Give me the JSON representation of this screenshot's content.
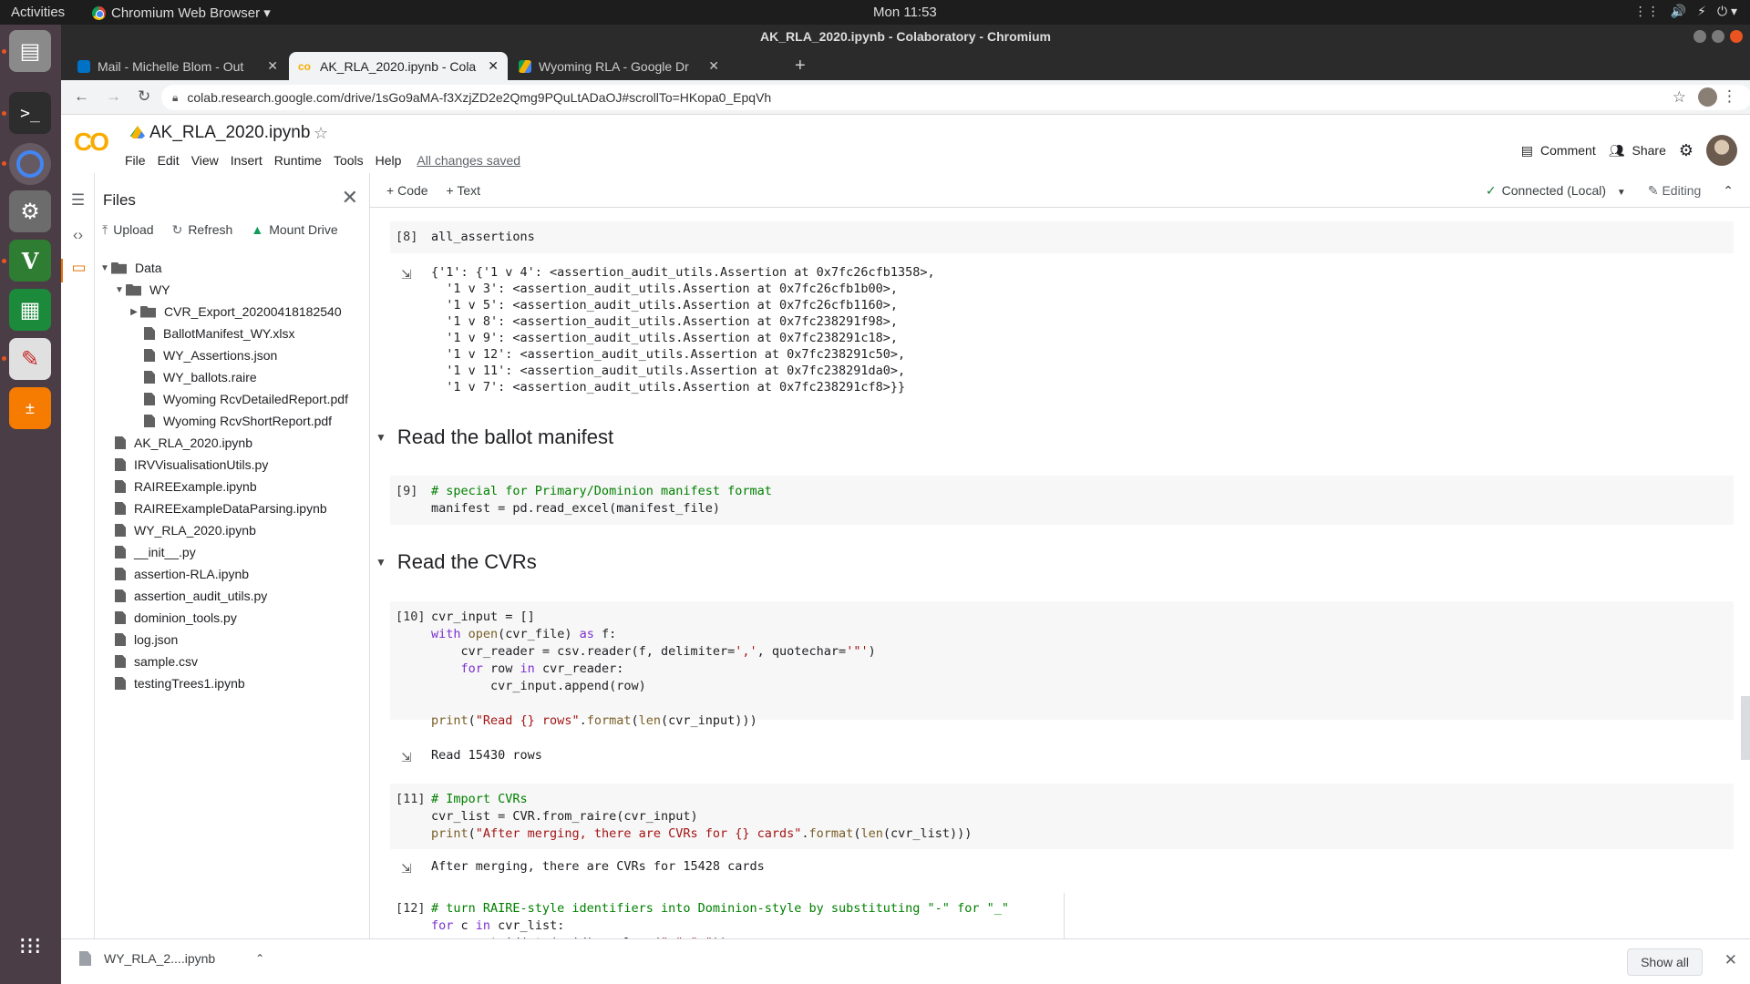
{
  "topbar": {
    "activities": "Activities",
    "app_name": "Chromium Web Browser ▾",
    "clock": "Mon 11:53",
    "tray": [
      "⋮⋮",
      "🔊",
      "⚡",
      "⏻ ▾"
    ]
  },
  "window": {
    "title": "AK_RLA_2020.ipynb - Colaboratory - Chromium"
  },
  "tabs": [
    {
      "label": "Mail - Michelle Blom - Out",
      "color": "#0072c6"
    },
    {
      "label": "AK_RLA_2020.ipynb - Cola",
      "color": "#f9ab00"
    },
    {
      "label": "Wyoming RLA - Google Dr",
      "color": "#0f9d58"
    }
  ],
  "url": "colab.research.google.com/drive/1sGo9aMA-f3XzjZD2e2Qmg9PQuLtADaOJ#scrollTo=HKopa0_EpqVh",
  "colab": {
    "logo": "CO",
    "notebook_name": "AK_RLA_2020.ipynb",
    "menus": [
      "File",
      "Edit",
      "View",
      "Insert",
      "Runtime",
      "Tools",
      "Help"
    ],
    "saved": "All changes saved",
    "comment": "Comment",
    "share": "Share"
  },
  "files": {
    "title": "Files",
    "upload": "Upload",
    "refresh": "Refresh",
    "mount": "Mount Drive",
    "tree": [
      {
        "name": "Data",
        "kind": "folder",
        "depth": 0,
        "caret": "▼"
      },
      {
        "name": "WY",
        "kind": "folder",
        "depth": 1,
        "caret": "▼"
      },
      {
        "name": "CVR_Export_20200418182540",
        "kind": "folder",
        "depth": 2,
        "caret": "▶"
      },
      {
        "name": "BallotManifest_WY.xlsx",
        "kind": "file",
        "depth": 2,
        "caret": ""
      },
      {
        "name": "WY_Assertions.json",
        "kind": "file",
        "depth": 2,
        "caret": ""
      },
      {
        "name": "WY_ballots.raire",
        "kind": "file",
        "depth": 2,
        "caret": ""
      },
      {
        "name": "Wyoming RcvDetailedReport.pdf",
        "kind": "file",
        "depth": 2,
        "caret": ""
      },
      {
        "name": "Wyoming RcvShortReport.pdf",
        "kind": "file",
        "depth": 2,
        "caret": ""
      },
      {
        "name": "AK_RLA_2020.ipynb",
        "kind": "file",
        "depth": 0,
        "caret": ""
      },
      {
        "name": "IRVVisualisationUtils.py",
        "kind": "file",
        "depth": 0,
        "caret": ""
      },
      {
        "name": "RAIREExample.ipynb",
        "kind": "file",
        "depth": 0,
        "caret": ""
      },
      {
        "name": "RAIREExampleDataParsing.ipynb",
        "kind": "file",
        "depth": 0,
        "caret": ""
      },
      {
        "name": "WY_RLA_2020.ipynb",
        "kind": "file",
        "depth": 0,
        "caret": ""
      },
      {
        "name": "__init__.py",
        "kind": "file",
        "depth": 0,
        "caret": ""
      },
      {
        "name": "assertion-RLA.ipynb",
        "kind": "file",
        "depth": 0,
        "caret": ""
      },
      {
        "name": "assertion_audit_utils.py",
        "kind": "file",
        "depth": 0,
        "caret": ""
      },
      {
        "name": "dominion_tools.py",
        "kind": "file",
        "depth": 0,
        "caret": ""
      },
      {
        "name": "log.json",
        "kind": "file",
        "depth": 0,
        "caret": ""
      },
      {
        "name": "sample.csv",
        "kind": "file",
        "depth": 0,
        "caret": ""
      },
      {
        "name": "testingTrees1.ipynb",
        "kind": "file",
        "depth": 0,
        "caret": ""
      }
    ]
  },
  "toolbar": {
    "code": "Code",
    "text": "Text",
    "connected": "Connected (Local)",
    "editing": "Editing"
  },
  "cells": {
    "c8_num": "[8]",
    "c8_code": "all_assertions",
    "c8_out": "{'1': {'1 v 4': <assertion_audit_utils.Assertion at 0x7fc26cfb1358>,\n  '1 v 3': <assertion_audit_utils.Assertion at 0x7fc26cfb1b00>,\n  '1 v 5': <assertion_audit_utils.Assertion at 0x7fc26cfb1160>,\n  '1 v 8': <assertion_audit_utils.Assertion at 0x7fc238291f98>,\n  '1 v 9': <assertion_audit_utils.Assertion at 0x7fc238291c18>,\n  '1 v 12': <assertion_audit_utils.Assertion at 0x7fc238291c50>,\n  '1 v 11': <assertion_audit_utils.Assertion at 0x7fc238291da0>,\n  '1 v 7': <assertion_audit_utils.Assertion at 0x7fc238291cf8>}}",
    "sec1": "Read the ballot manifest",
    "c9_num": "[9]",
    "c9_l1": "# special for Primary/Dominion manifest format",
    "c9_l2": "manifest = pd.read_excel(manifest_file)",
    "sec2": "Read the CVRs",
    "c10_num": "[10]",
    "c10_out": "Read 15430 rows",
    "c11_num": "[11]",
    "c11_l1": "# Import CVRs",
    "c11_l2": "cvr_list = CVR.from_raire(cvr_input)",
    "c11_out": "After merging, there are CVRs for 15428 cards",
    "c12_num": "[12]",
    "c12_l1": "# turn RAIRE-style identifiers into Dominion-style by substituting \"-\" for \"_\""
  },
  "download": {
    "file": "WY_RLA_2....ipynb",
    "show_all": "Show all"
  }
}
